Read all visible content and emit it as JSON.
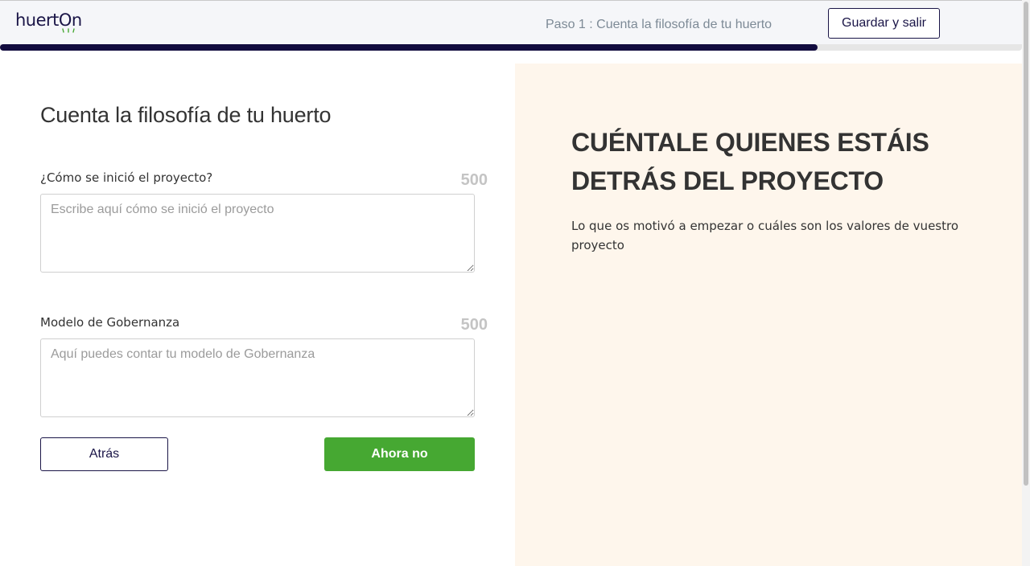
{
  "header": {
    "logo_text": "huertOn",
    "step_text": "Paso 1 : Cuenta la filosofía de tu huerto",
    "save_exit_label": "Guardar y salir",
    "progress_fraction": 0.8
  },
  "form": {
    "title": "Cuenta la filosofía de tu huerto",
    "fields": [
      {
        "label": "¿Cómo se inició el proyecto?",
        "char_count": "500",
        "placeholder": "Escribe aquí cómo se inició el proyecto",
        "value": ""
      },
      {
        "label": "Modelo de Gobernanza",
        "char_count": "500",
        "placeholder": "Aquí puedes contar tu modelo de Gobernanza",
        "value": ""
      }
    ],
    "back_label": "Atrás",
    "not_now_label": "Ahora no"
  },
  "info": {
    "heading": "CUÉNTALE QUIENES ESTÁIS DETRÁS DEL PROYECTO",
    "text": "Lo que os motivó a empezar o cuáles son los valores de vuestro proyecto"
  },
  "colors": {
    "brand_navy": "#1a1547",
    "progress": "#120c3f",
    "accent_green": "#46a832",
    "panel_bg": "#fef6ec"
  },
  "icons": {
    "logo_sprout": "sprout-icon"
  }
}
